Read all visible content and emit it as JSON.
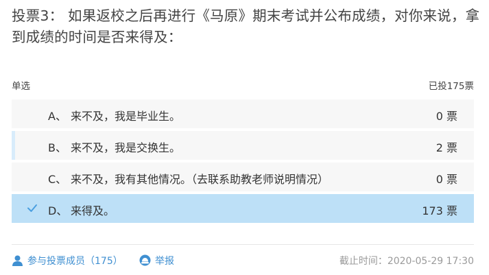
{
  "poll": {
    "title": "投票3： 如果返校之后再进行《马原》期末考试并公布成绩，对你来说，拿到成绩的时间是否来得及：",
    "type_label": "单选",
    "vote_summary": "已投175票"
  },
  "options": [
    {
      "letter": "A、",
      "text": "来不及，我是毕业生。",
      "count": "0 票"
    },
    {
      "letter": "B、",
      "text": "来不及，我是交换生。",
      "count": "2 票"
    },
    {
      "letter": "C、",
      "text": "来不及，我有其他情况。（去联系助教老师说明情况）",
      "count": "0 票"
    },
    {
      "letter": "D、",
      "text": "来得及。",
      "count": "173 票"
    }
  ],
  "selected_option": "D、",
  "footer": {
    "members_label": "参与投票成员（175）",
    "report_label": "举报",
    "deadline": "截止时间：2020-05-29 17:30"
  },
  "colors": {
    "selected_bg": "#bde0f7",
    "option_bg": "#f7f7f7",
    "accent": "#3f8fd1",
    "check": "#4a9fe0"
  },
  "icons": {
    "members": "user-icon",
    "report": "alert-icon",
    "selected": "check-icon"
  }
}
